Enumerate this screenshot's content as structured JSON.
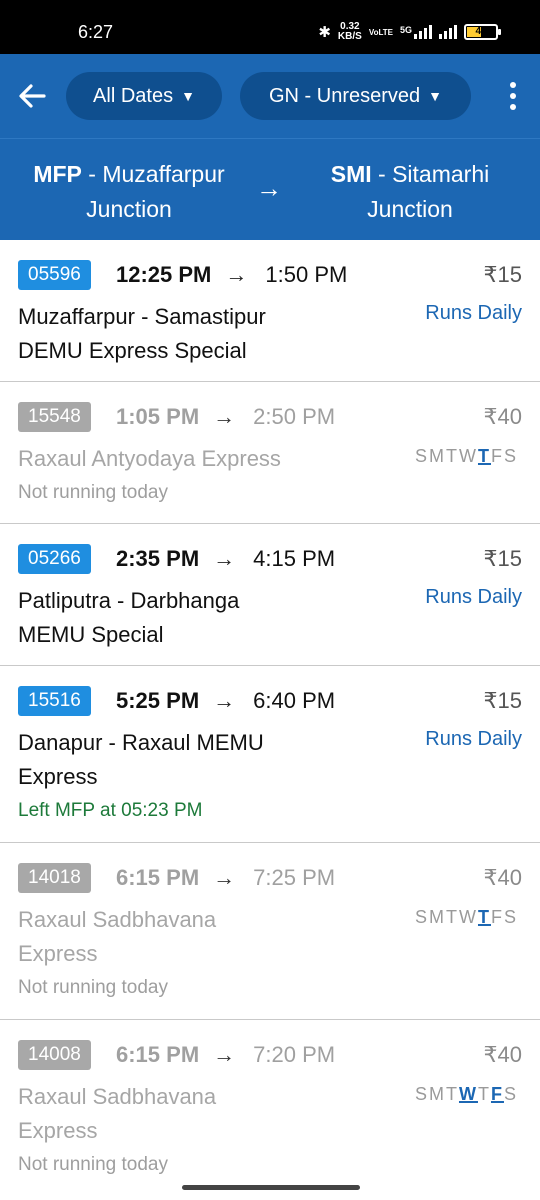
{
  "status_bar": {
    "time": "6:27",
    "speed_value": "0.32",
    "speed_unit": "KB/S",
    "volte": "VoLTE",
    "network": "5G",
    "battery": "40"
  },
  "appbar": {
    "back_icon": "arrow-left-icon",
    "date_filter": "All Dates",
    "class_filter": "GN - Unreserved",
    "more_icon": "more-vertical-icon"
  },
  "route": {
    "from_code": "MFP",
    "from_name_line1": "- Muzaffarpur",
    "from_name_line2": "Junction",
    "to_code": "SMI",
    "to_name_line1": "- Sitamarhi",
    "to_name_line2": "Junction",
    "arrow": "→"
  },
  "trains": [
    {
      "number": "05596",
      "dep": "12:25 PM",
      "arr": "1:50 PM",
      "fare": "₹15",
      "name_line1": "Muzaffarpur - Samastipur",
      "name_line2": "DEMU Express Special",
      "runs": "Runs Daily",
      "note": ""
    },
    {
      "number": "15548",
      "dep": "1:05 PM",
      "arr": "2:50 PM",
      "fare": "₹40",
      "name_line1": "Raxaul Antyodaya Express",
      "name_line2": "",
      "days": [
        "S",
        "M",
        "T",
        "W",
        "T",
        "F",
        "S"
      ],
      "note": "Not running today"
    },
    {
      "number": "05266",
      "dep": "2:35 PM",
      "arr": "4:15 PM",
      "fare": "₹15",
      "name_line1": "Patliputra - Darbhanga",
      "name_line2": "MEMU Special",
      "runs": "Runs Daily",
      "note": ""
    },
    {
      "number": "15516",
      "dep": "5:25 PM",
      "arr": "6:40 PM",
      "fare": "₹15",
      "name_line1": "Danapur - Raxaul MEMU",
      "name_line2": "Express",
      "runs": "Runs Daily",
      "note": "Left MFP at 05:23 PM"
    },
    {
      "number": "14018",
      "dep": "6:15 PM",
      "arr": "7:25 PM",
      "fare": "₹40",
      "name_line1": "Raxaul Sadbhavana",
      "name_line2": "Express",
      "days": [
        "S",
        "M",
        "T",
        "W",
        "T",
        "F",
        "S"
      ],
      "note": "Not running today"
    },
    {
      "number": "14008",
      "dep": "6:15 PM",
      "arr": "7:20 PM",
      "fare": "₹40",
      "name_line1": "Raxaul Sadbhavana",
      "name_line2": "Express",
      "days": [
        "S",
        "M",
        "T",
        "W",
        "T",
        "F",
        "S"
      ],
      "note": "Not running today"
    }
  ],
  "arrow_glyph": "→",
  "colors": {
    "primary": "#1c67b3",
    "chip": "#0f4f8f",
    "badge_active": "#1f8ee0",
    "badge_inactive": "#a8a8a8",
    "live_status": "#1d7a3a"
  }
}
